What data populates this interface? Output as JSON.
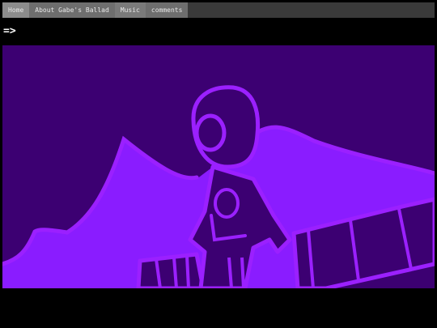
{
  "nav": {
    "items": [
      {
        "label": "Home"
      },
      {
        "label": "About Gabe's Ballad"
      },
      {
        "label": "Music"
      },
      {
        "label": "comments"
      }
    ]
  },
  "command": {
    "text": "=>"
  },
  "panel": {
    "colors": {
      "background": "#3c0072",
      "line": "#9b20ff",
      "fill": "#8a1cff"
    }
  }
}
